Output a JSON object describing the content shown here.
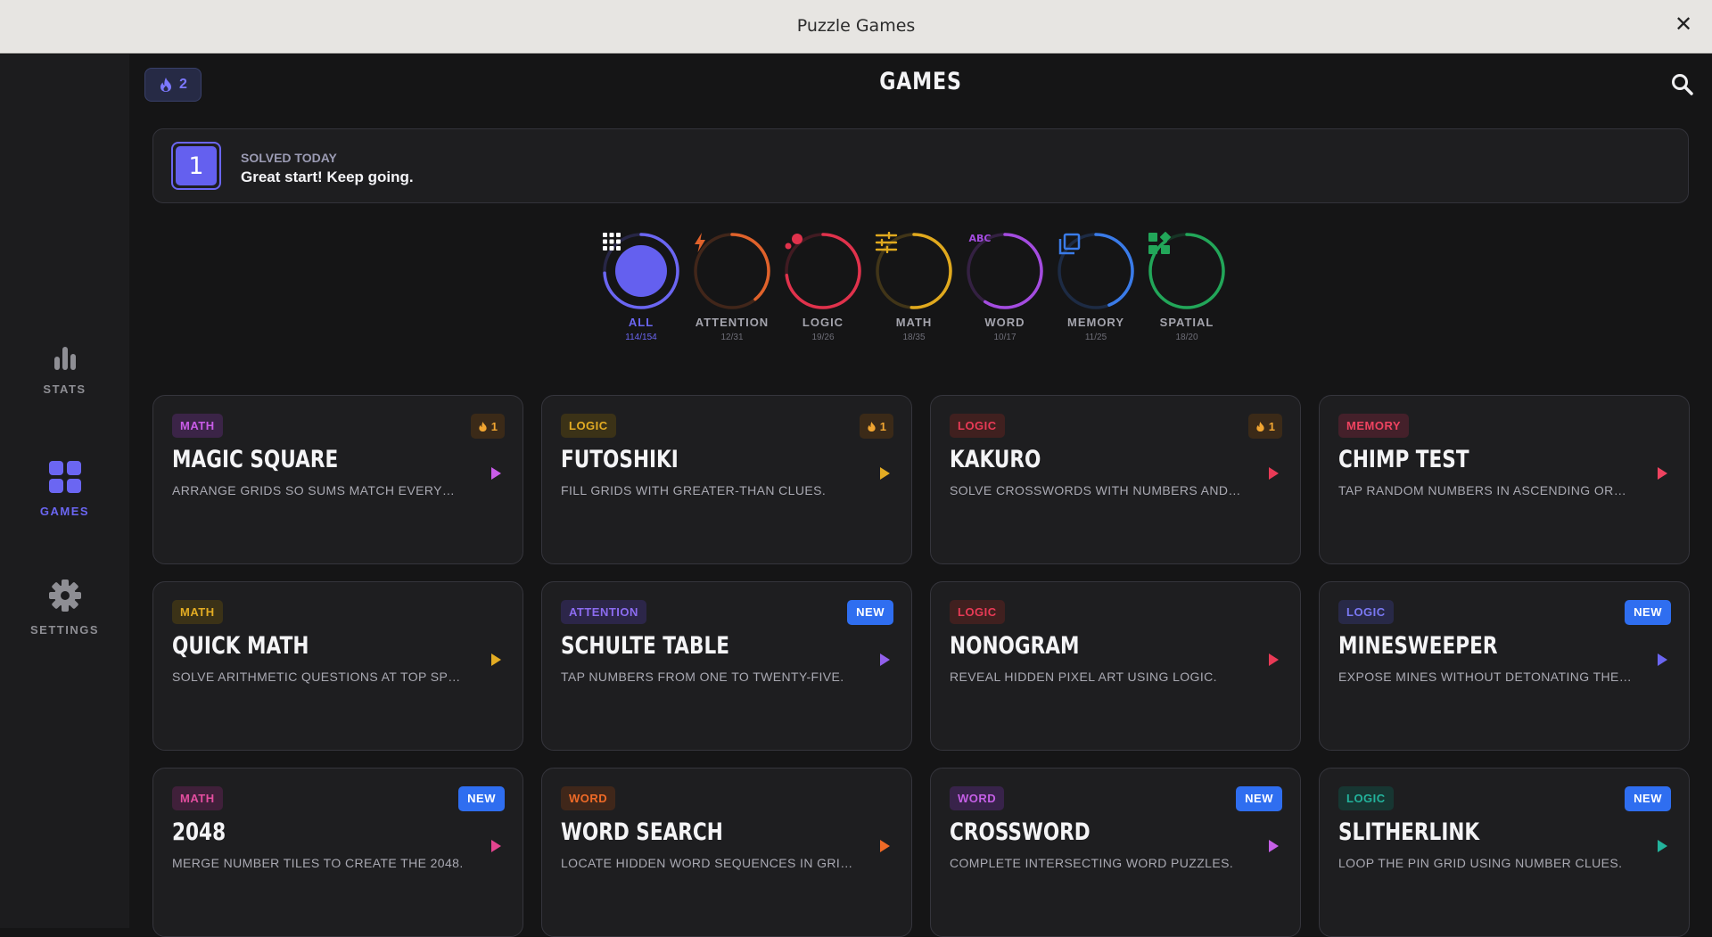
{
  "window": {
    "title": "Puzzle Games"
  },
  "header": {
    "streak_count": "2",
    "title": "GAMES"
  },
  "sidebar": {
    "items": [
      {
        "id": "stats",
        "label": "STATS",
        "icon": "bar-chart-icon"
      },
      {
        "id": "games",
        "label": "GAMES",
        "icon": "grid-icon",
        "active": true
      },
      {
        "id": "settings",
        "label": "SETTINGS",
        "icon": "gear-icon"
      }
    ]
  },
  "solved": {
    "count": "1",
    "label": "SOLVED TODAY",
    "message": "Great start! Keep going."
  },
  "categories": [
    {
      "id": "all",
      "label": "ALL",
      "progress_text": "114/154",
      "progress": 0.74,
      "color": "#6b66f2",
      "icon": "grid-icon",
      "active": true
    },
    {
      "id": "attention",
      "label": "ATTENTION",
      "progress_text": "12/31",
      "progress": 0.39,
      "color": "#e0622b",
      "icon": "lightning-icon"
    },
    {
      "id": "logic",
      "label": "LOGIC",
      "progress_text": "19/26",
      "progress": 0.73,
      "color": "#e0324c",
      "icon": "dots-icon"
    },
    {
      "id": "math",
      "label": "MATH",
      "progress_text": "18/35",
      "progress": 0.51,
      "color": "#e0a91e",
      "icon": "sliders-icon"
    },
    {
      "id": "word",
      "label": "WORD",
      "progress_text": "10/17",
      "progress": 0.59,
      "color": "#a44ce0",
      "icon": "abc-icon"
    },
    {
      "id": "memory",
      "label": "MEMORY",
      "progress_text": "11/25",
      "progress": 0.44,
      "color": "#3a7be8",
      "icon": "layers-icon"
    },
    {
      "id": "spatial",
      "label": "SPATIAL",
      "progress_text": "18/20",
      "progress": 0.9,
      "color": "#22a659",
      "icon": "shapes-icon"
    }
  ],
  "cards": [
    {
      "name": "MAGIC SQUARE",
      "tag": "MATH",
      "tag_fg": "#c95ce8",
      "tag_bg": "#3b2447",
      "desc": "ARRANGE GRIDS SO SUMS MATCH EVERYWHERE.",
      "play": "#c95ce8",
      "badge": "streak",
      "badge_text": "1"
    },
    {
      "name": "FUTOSHIKI",
      "tag": "LOGIC",
      "tag_fg": "#e3ac23",
      "tag_bg": "#3b3217",
      "desc": "FILL GRIDS WITH GREATER-THAN CLUES.",
      "play": "#e3ac23",
      "badge": "streak",
      "badge_text": "1"
    },
    {
      "name": "KAKURO",
      "tag": "LOGIC",
      "tag_fg": "#e93a56",
      "tag_bg": "#40201f",
      "desc": "SOLVE CROSSWORDS WITH NUMBERS AND SUMS.",
      "play": "#e93a56",
      "badge": "streak",
      "badge_text": "1"
    },
    {
      "name": "CHIMP TEST",
      "tag": "MEMORY",
      "tag_fg": "#ef4360",
      "tag_bg": "#44202a",
      "desc": "TAP RANDOM NUMBERS IN ASCENDING ORDER.",
      "play": "#ef4360",
      "badge": "",
      "badge_text": ""
    },
    {
      "name": "QUICK MATH",
      "tag": "MATH",
      "tag_fg": "#e3ac23",
      "tag_bg": "#3b3217",
      "desc": "SOLVE ARITHMETIC QUESTIONS AT TOP SPEED.",
      "play": "#e3ac23",
      "badge": "",
      "badge_text": ""
    },
    {
      "name": "SCHULTE TABLE",
      "tag": "ATTENTION",
      "tag_fg": "#8c6cf0",
      "tag_bg": "#2c2649",
      "desc": "TAP NUMBERS FROM ONE TO TWENTY-FIVE.",
      "play": "#9260ec",
      "badge": "new",
      "badge_text": "NEW"
    },
    {
      "name": "NONOGRAM",
      "tag": "LOGIC",
      "tag_fg": "#e93a56",
      "tag_bg": "#40201f",
      "desc": "REVEAL HIDDEN PIXEL ART USING LOGIC.",
      "play": "#e93a56",
      "badge": "",
      "badge_text": ""
    },
    {
      "name": "MINESWEEPER",
      "tag": "LOGIC",
      "tag_fg": "#7a78f3",
      "tag_bg": "#282947",
      "desc": "EXPOSE MINES WITHOUT DETONATING THEM.",
      "play": "#6b66f2",
      "badge": "new",
      "badge_text": "NEW"
    },
    {
      "name": "2048",
      "tag": "MATH",
      "tag_fg": "#e44ea0",
      "tag_bg": "#40203a",
      "desc": "MERGE NUMBER TILES TO CREATE THE 2048.",
      "play": "#e4448f",
      "badge": "new",
      "badge_text": "NEW"
    },
    {
      "name": "WORD SEARCH",
      "tag": "WORD",
      "tag_fg": "#ef6a27",
      "tag_bg": "#40271a",
      "desc": "LOCATE HIDDEN WORD SEQUENCES IN GRIDS.",
      "play": "#ef6a27",
      "badge": "",
      "badge_text": ""
    },
    {
      "name": "CROSSWORD",
      "tag": "WORD",
      "tag_fg": "#c55fe6",
      "tag_bg": "#38234a",
      "desc": "COMPLETE INTERSECTING WORD PUZZLES.",
      "play": "#c55fe6",
      "badge": "new",
      "badge_text": "NEW"
    },
    {
      "name": "SLITHERLINK",
      "tag": "LOGIC",
      "tag_fg": "#23b39c",
      "tag_bg": "#173632",
      "desc": "LOOP THE PIN GRID USING NUMBER CLUES.",
      "play": "#23b39c",
      "badge": "new",
      "badge_text": "NEW"
    }
  ]
}
